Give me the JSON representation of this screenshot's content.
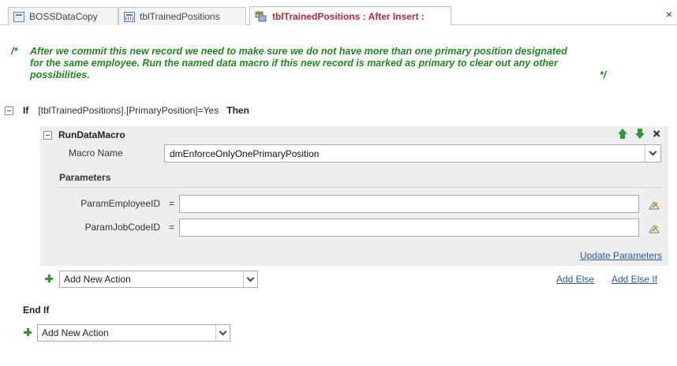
{
  "tabs": [
    {
      "label": "BOSSDataCopy",
      "icon": "table-icon",
      "active": false
    },
    {
      "label": "tblTrainedPositions",
      "icon": "datasheet-icon",
      "active": false
    },
    {
      "label": "tblTrainedPositions : After Insert :",
      "icon": "data-macro-icon",
      "active": true
    }
  ],
  "close_glyph": "×",
  "comment": {
    "open": "/*",
    "text": "After we commit this new record we need to make sure we do not have more than one primary position designated for the same employee. Run the named data macro if this new record is marked as primary to clear out any other possibilities.",
    "close": "*/"
  },
  "if_block": {
    "keyword_if": "If",
    "condition": "[tblTrainedPositions].[PrimaryPosition]=Yes",
    "keyword_then": "Then",
    "keyword_end": "End If"
  },
  "run_data_macro": {
    "title": "RunDataMacro",
    "macro_name_label": "Macro Name",
    "macro_name_value": "dmEnforceOnlyOnePrimaryPosition",
    "parameters_label": "Parameters",
    "params": [
      {
        "label": "ParamEmployeeID",
        "eq": "=",
        "value": ""
      },
      {
        "label": "ParamJobCodeID",
        "eq": "=",
        "value": ""
      }
    ],
    "update_parameters": "Update Parameters"
  },
  "inner_add_action": "Add New Action",
  "add_else": "Add Else",
  "add_else_if": "Add Else If",
  "outer_add_action": "Add New Action",
  "colors": {
    "comment": "#1f8a1f",
    "active_tab": "#c0262d",
    "link": "#2a5a9a",
    "plus": "#2b9a36"
  }
}
